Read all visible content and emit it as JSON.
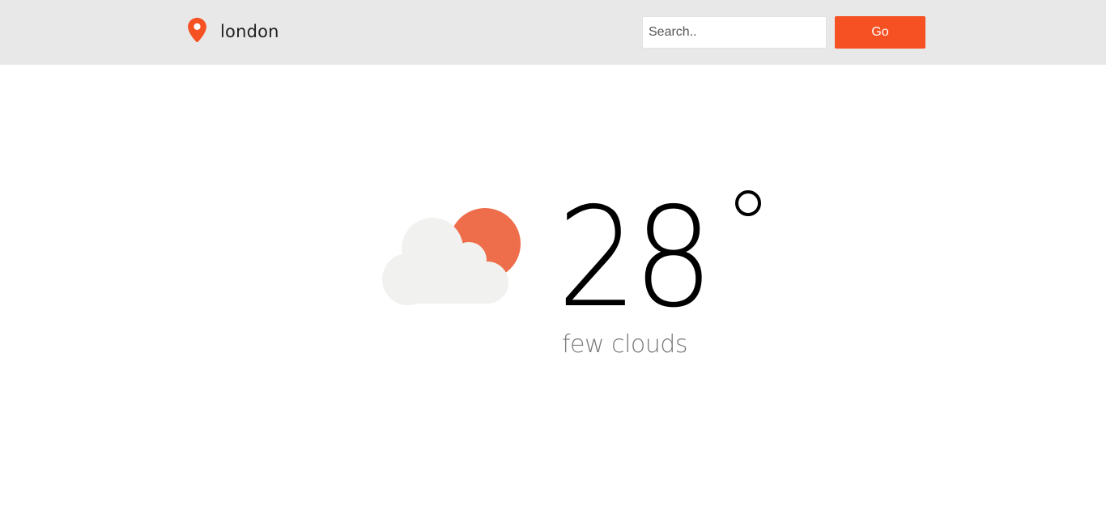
{
  "header": {
    "location_icon": "map-pin-icon",
    "city": "london",
    "search": {
      "placeholder": "Search..",
      "value": ""
    },
    "go_label": "Go"
  },
  "weather": {
    "icon": "partly-cloudy-icon",
    "temperature": "28",
    "degree_symbol": "degree-circle-icon",
    "condition": "few clouds"
  },
  "colors": {
    "accent": "#f55123",
    "sun": "#ee6e4b",
    "cloud": "#f1f1f0",
    "header_bg": "#e8e8e8",
    "condition_text": "#7a7a7a"
  }
}
